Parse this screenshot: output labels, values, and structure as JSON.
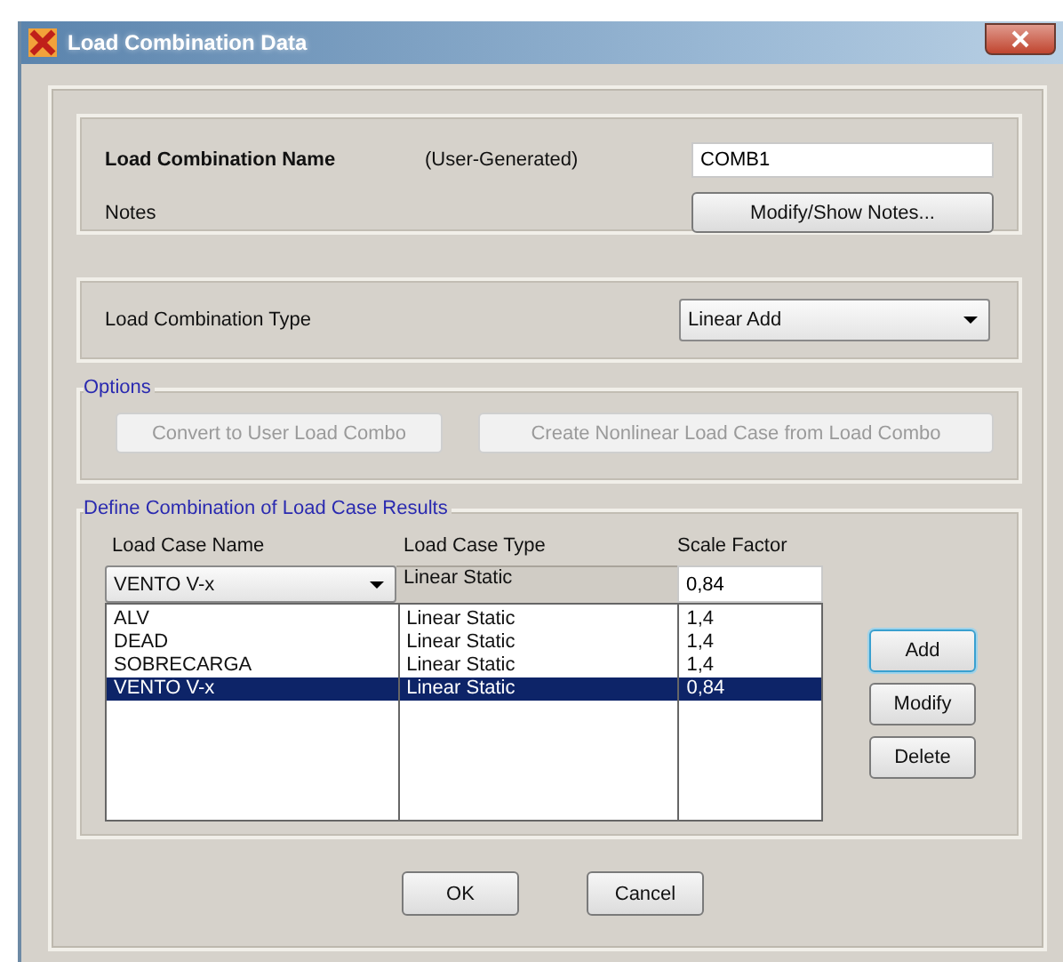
{
  "window": {
    "title": "Load Combination Data"
  },
  "name_section": {
    "name_label": "Load Combination Name",
    "name_note": "(User-Generated)",
    "name_value": "COMB1",
    "notes_label": "Notes",
    "notes_button": "Modify/Show Notes..."
  },
  "type_section": {
    "label": "Load Combination Type",
    "value": "Linear Add"
  },
  "options": {
    "title": "Options",
    "buttons": [
      {
        "label": "Convert to User Load Combo",
        "disabled": true
      },
      {
        "label": "Create Nonlinear Load Case from Load Combo",
        "disabled": true
      }
    ]
  },
  "define": {
    "title": "Define Combination of Load Case Results",
    "columns": [
      "Load Case Name",
      "Load Case Type",
      "Scale Factor"
    ],
    "edit_row": {
      "name": "VENTO V-x",
      "type": "Linear Static",
      "factor": "0,84"
    },
    "rows": [
      {
        "name": "ALV",
        "type": "Linear Static",
        "factor": "1,4",
        "selected": false
      },
      {
        "name": "DEAD",
        "type": "Linear Static",
        "factor": "1,4",
        "selected": false
      },
      {
        "name": "SOBRECARGA",
        "type": "Linear Static",
        "factor": "1,4",
        "selected": false
      },
      {
        "name": "VENTO V-x",
        "type": "Linear Static",
        "factor": "0,84",
        "selected": true
      }
    ],
    "buttons": [
      "Add",
      "Modify",
      "Delete"
    ]
  },
  "footer_buttons": [
    "OK",
    "Cancel"
  ]
}
